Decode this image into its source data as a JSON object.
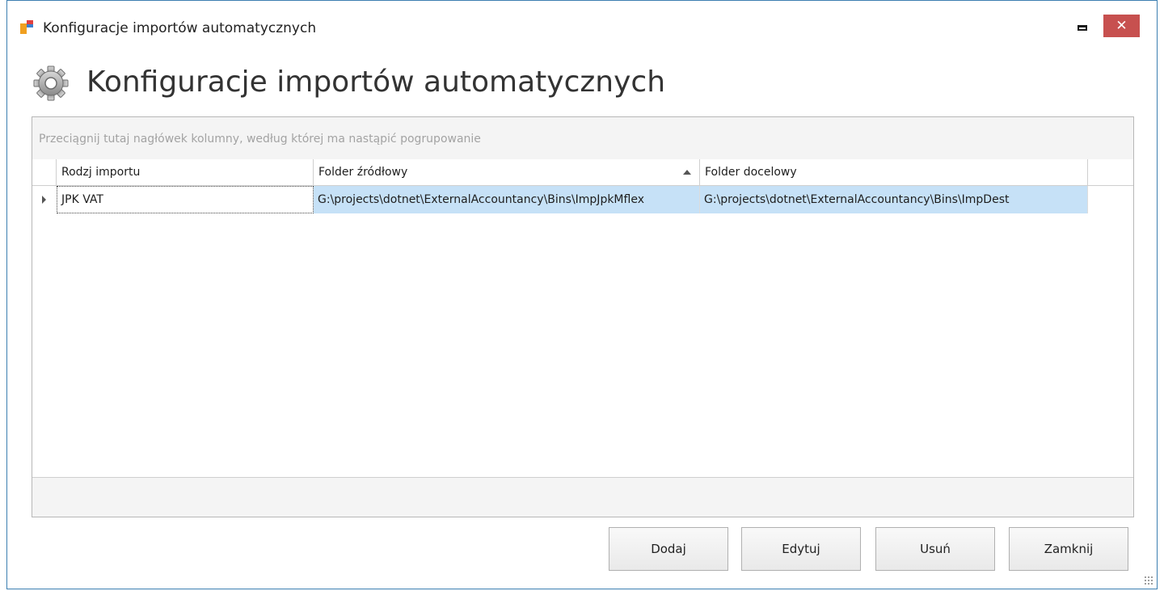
{
  "window": {
    "title": "Konfiguracje importów automatycznych",
    "close_label": "✕"
  },
  "header": {
    "title": "Konfiguracje importów automatycznych"
  },
  "grid": {
    "group_hint": "Przeciągnij tutaj nagłówek kolumny, według której ma nastąpić pogrupowanie",
    "columns": [
      {
        "label": "Rodzj importu"
      },
      {
        "label": "Folder źródłowy",
        "sorted": "ascending"
      },
      {
        "label": "Folder docelowy"
      }
    ],
    "rows": [
      {
        "import_type": "JPK VAT",
        "source_folder": "G:\\projects\\dotnet\\ExternalAccountancy\\Bins\\ImpJpkMflex",
        "target_folder": "G:\\projects\\dotnet\\ExternalAccountancy\\Bins\\ImpDest"
      }
    ]
  },
  "buttons": {
    "add": "Dodaj",
    "edit": "Edytuj",
    "delete": "Usuń",
    "close": "Zamknij"
  },
  "colors": {
    "selection": "#c6e1f7",
    "close_button": "#c7504f",
    "window_border": "#3c7fb1"
  }
}
